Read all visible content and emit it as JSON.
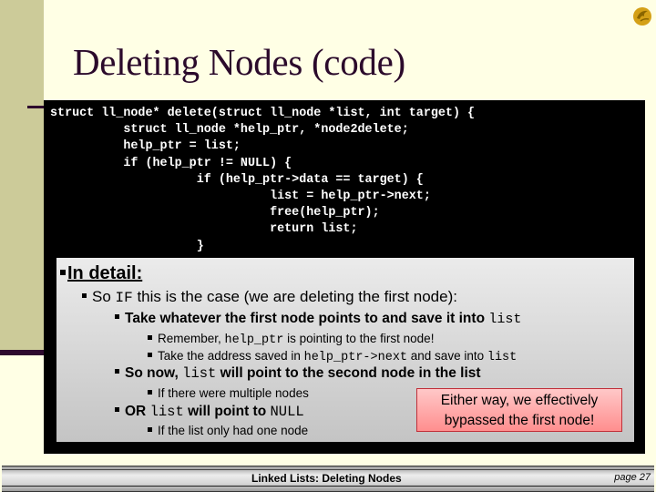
{
  "slide": {
    "title": "Deleting Nodes (code)",
    "logo": "pegasus-logo-icon",
    "code_lines": [
      "struct ll_node* delete(struct ll_node *list, int target) {",
      "          struct ll_node *help_ptr, *node2delete;",
      "          help_ptr = list;",
      "          if (help_ptr != NULL) {",
      "                    if (help_ptr->data == target) {",
      "                              list = help_ptr->next;",
      "                              free(help_ptr);",
      "                              return list;",
      "                    }"
    ],
    "detail": {
      "heading": "In detail:",
      "l2": {
        "a": "So ",
        "code": "IF",
        "b": " this is the case (we are deleting the first node):"
      },
      "l3": {
        "a": "Take whatever the first node points to and save it into ",
        "code": "list"
      },
      "l4": {
        "a": "Remember, ",
        "code": "help_ptr",
        "b": " is pointing to the first node!"
      },
      "l5": {
        "a": "Take the address saved in ",
        "code": "help_ptr->next",
        "b": " and save into ",
        "code2": "list"
      },
      "l6": {
        "a": "So now, ",
        "code": "list",
        "b": " will point to the second node in the list"
      },
      "l7": "If there were multiple nodes",
      "l8": {
        "a": "OR ",
        "code": "list",
        "b": " will point to ",
        "code2": "NULL"
      },
      "l9": "If the list only had one node",
      "note_line1": "Either way, we effectively",
      "note_line2": "bypassed the first node!"
    }
  },
  "footer": {
    "title": "Linked Lists:  Deleting Nodes",
    "page": "page 27"
  },
  "colors": {
    "background": "#FFFFE5",
    "sidebar": "#CCCB99",
    "title": "#2B0A2B",
    "code_bg": "#000000",
    "note_bg": "#FF9E9E",
    "note_border": "#C0303A"
  }
}
